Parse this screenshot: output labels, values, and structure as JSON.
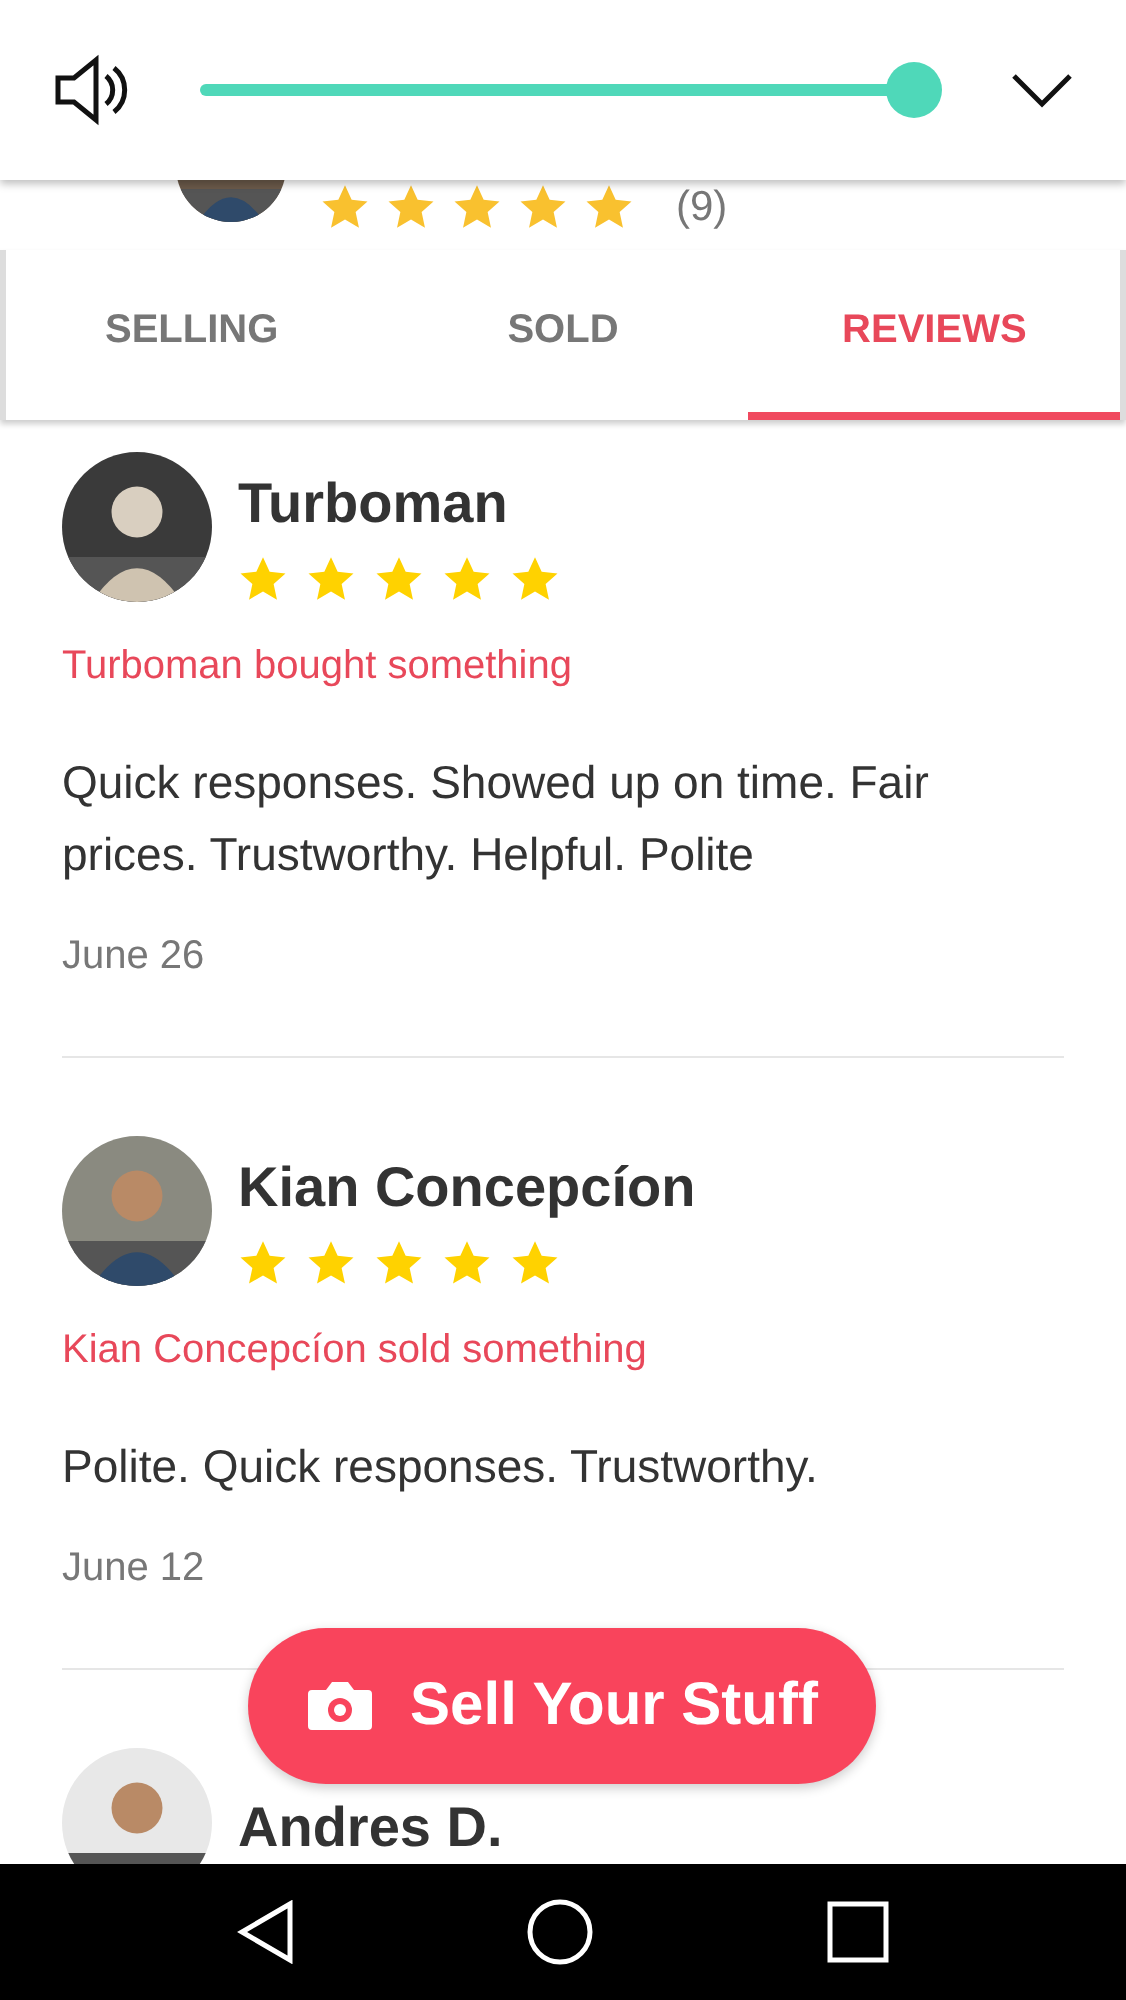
{
  "volume": {
    "level": 1
  },
  "profile": {
    "stars": 5,
    "rating_count": "(9)"
  },
  "tabs": [
    {
      "label": "SELLING",
      "selected": false
    },
    {
      "label": "SOLD",
      "selected": false
    },
    {
      "label": "REVIEWS",
      "selected": true
    }
  ],
  "reviews": [
    {
      "name": "Turboman",
      "stars": 5,
      "activity": "Turboman bought something",
      "text": "Quick responses. Showed up on time. Fair prices. Trustworthy. Helpful. Polite",
      "date": "June 26"
    },
    {
      "name": "Kian Concepcíon",
      "stars": 5,
      "activity": "Kian Concepcíon sold something",
      "text": "Polite. Quick responses. Trustworthy.",
      "date": "June 12"
    },
    {
      "name": "Andres D."
    }
  ],
  "fab": {
    "label": "Sell Your Stuff"
  }
}
